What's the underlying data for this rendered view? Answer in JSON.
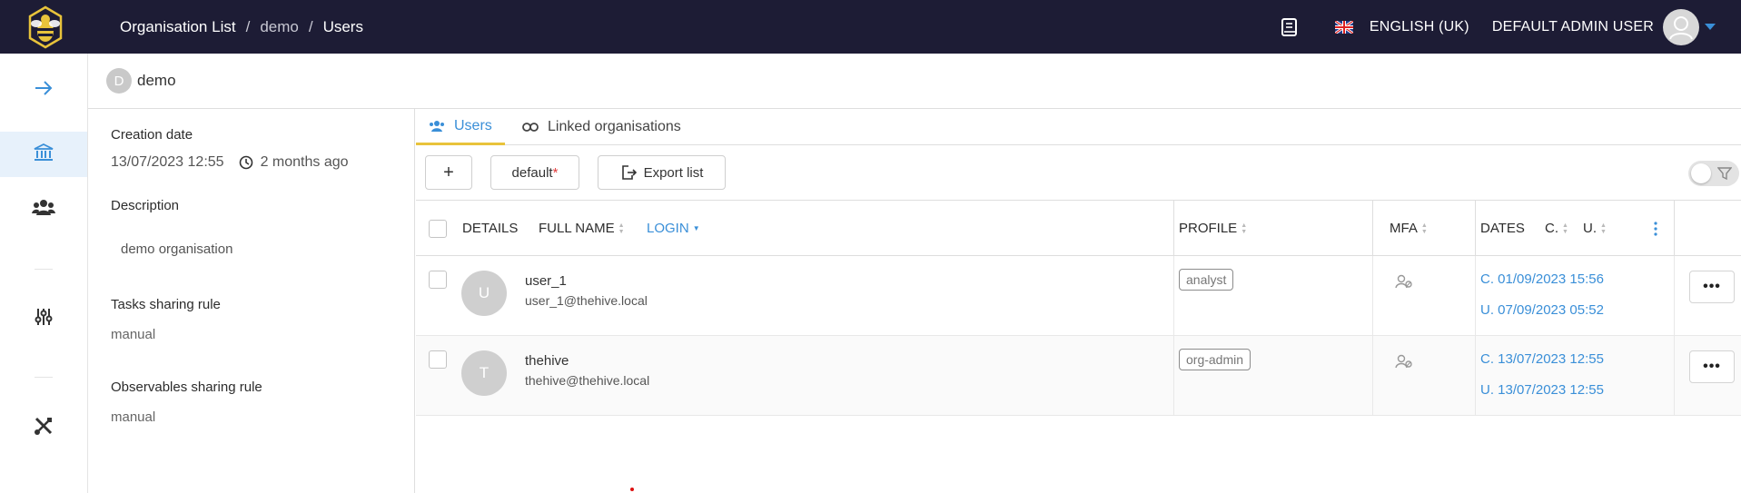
{
  "topbar": {
    "breadcrumb": [
      "Organisation List",
      "demo",
      "Users"
    ],
    "language": "ENGLISH (UK)",
    "user_name": "DEFAULT ADMIN USER",
    "bg_color": "#1d1c35"
  },
  "sidebar": {
    "items": [
      {
        "icon": "arrow-right-icon"
      },
      {
        "icon": "bank-icon",
        "active": true
      },
      {
        "icon": "users-icon"
      },
      {
        "icon": "sliders-icon"
      },
      {
        "icon": "tools-icon"
      }
    ]
  },
  "org": {
    "avatar_letter": "D",
    "name": "demo"
  },
  "details": {
    "creation_date_label": "Creation date",
    "creation_date": "13/07/2023 12:55",
    "creation_ago": "2 months ago",
    "description_label": "Description",
    "description": "demo organisation",
    "tasks_rule_label": "Tasks sharing rule",
    "tasks_rule": "manual",
    "observables_rule_label": "Observables sharing rule",
    "observables_rule": "manual"
  },
  "tabs": [
    {
      "label": "Users",
      "active": true
    },
    {
      "label": "Linked organisations",
      "active": false
    }
  ],
  "toolbar": {
    "add_label": "+",
    "filter_preset": "default",
    "filter_preset_mark": "*",
    "export_label": "Export list"
  },
  "table": {
    "headers": {
      "details": "DETAILS",
      "full_name": "FULL NAME",
      "login": "LOGIN",
      "profile": "PROFILE",
      "mfa": "MFA",
      "dates": "DATES",
      "created_short": "C.",
      "updated_short": "U."
    },
    "rows": [
      {
        "avatar_letter": "U",
        "name": "user_1",
        "login": "user_1@thehive.local",
        "profile": "analyst",
        "created": "C. 01/09/2023 15:56",
        "updated": "U. 07/09/2023 05:52"
      },
      {
        "avatar_letter": "T",
        "name": "thehive",
        "login": "thehive@thehive.local",
        "profile": "org-admin",
        "created": "C. 13/07/2023 12:55",
        "updated": "U. 13/07/2023 12:55"
      }
    ]
  },
  "colors": {
    "accent": "#3a8fd8",
    "tab_underline": "#e8c33b"
  }
}
